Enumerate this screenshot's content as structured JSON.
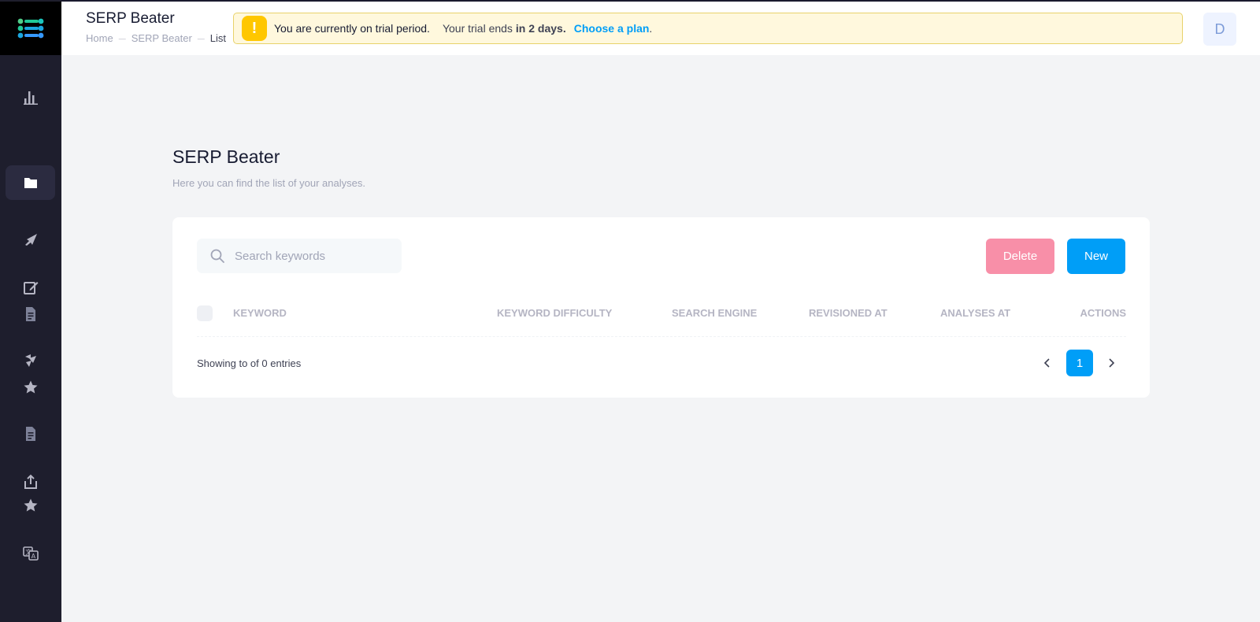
{
  "header": {
    "title": "SERP Beater",
    "breadcrumb": [
      "Home",
      "SERP Beater",
      "List"
    ],
    "trial": {
      "message": "You are currently on trial period.",
      "ends_prefix": "Your trial ends",
      "ends_value": "in 2 days.",
      "cta": "Choose a plan",
      "cta_suffix": "."
    },
    "avatar_initial": "D"
  },
  "sidebar": {
    "items": [
      {
        "icon": "bar-chart-icon",
        "active": false
      },
      {
        "icon": "folder-icon",
        "active": true
      },
      {
        "icon": "rocket-icon",
        "active": false
      },
      {
        "icon": "edit-icon",
        "active": false
      },
      {
        "icon": "document-icon",
        "active": false
      },
      {
        "icon": "wand-icon",
        "active": false
      },
      {
        "icon": "star-icon",
        "active": false
      },
      {
        "icon": "document-icon",
        "active": false
      },
      {
        "icon": "share-icon",
        "active": false
      },
      {
        "icon": "star-icon",
        "active": false
      },
      {
        "icon": "translate-icon",
        "active": false
      }
    ]
  },
  "page": {
    "title": "SERP Beater",
    "subtitle": "Here you can find the list of your analyses."
  },
  "toolbar": {
    "search_placeholder": "Search keywords",
    "delete_label": "Delete",
    "new_label": "New"
  },
  "table": {
    "columns": [
      "KEYWORD",
      "KEYWORD DIFFICULTY",
      "SEARCH ENGINE",
      "REVISIONED AT",
      "ANALYSES AT",
      "ACTIONS"
    ],
    "rows": []
  },
  "footer": {
    "entries_text": "Showing to of 0 entries",
    "current_page": "1"
  },
  "colors": {
    "sidebar_bg": "#1e1e2d",
    "primary": "#009ef7",
    "danger_light": "#f88fa8",
    "warning": "#ffc700",
    "warning_bg": "#fff8dd"
  }
}
